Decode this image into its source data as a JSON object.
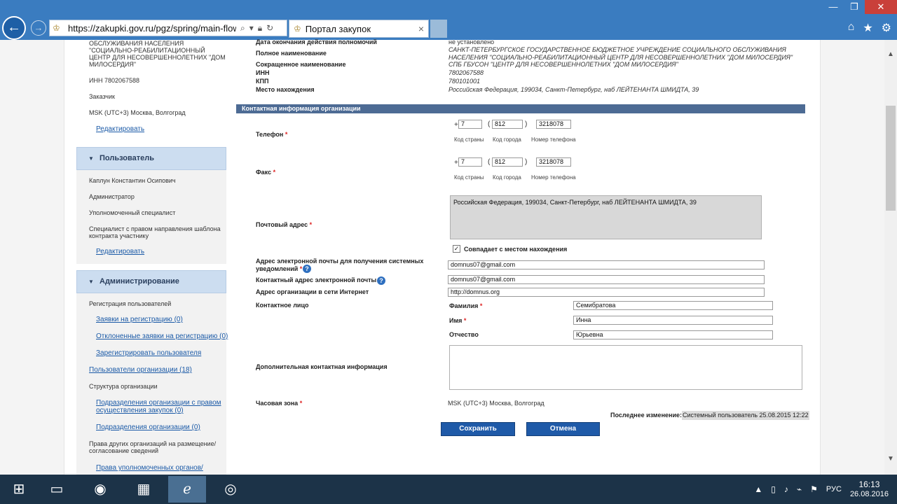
{
  "browser": {
    "url": "https://zakupki.gov.ru/pgz/spring/main-flow?",
    "tab_title": "Портал закупок",
    "tab_close": "×"
  },
  "sidebar": {
    "org_name_fragment": "ОБСЛУЖИВАНИЯ НАСЕЛЕНИЯ \"СОЦИАЛЬНО-РЕАБИЛИТАЦИОННЫЙ ЦЕНТР ДЛЯ НЕСОВЕРШЕННОЛЕТНИХ \"ДОМ МИЛОСЕРДИЯ\"",
    "inn": "ИНН 7802067588",
    "role": "Заказчик",
    "timezone": "MSK (UTC+3) Москва, Волгоград",
    "edit_link_1": "Редактировать",
    "user_header": "Пользователь",
    "user_name": "Каплун Константин Осипович",
    "user_role_1": "Администратор",
    "user_role_2": "Уполномоченный специалист",
    "user_role_3": "Специалист с правом направления шаблона контракта участнику",
    "edit_link_2": "Редактировать",
    "admin_header": "Администрирование",
    "reg_users": "Регистрация пользователей",
    "reg_requests": "Заявки на регистрацию (0)",
    "rejected_requests": "Отклоненные заявки на регистрацию (0)",
    "register_user": "Зарегистрировать пользователя",
    "org_users": "Пользователи организации (18)",
    "org_structure": "Структура организации",
    "subdivisions_with_right": "Подразделения организации с правом осуществления закупок (0)",
    "subdivisions": "Подразделения организации (0)",
    "other_org_rights": "Права других организаций на размещение/согласование сведений",
    "authorized_bodies": "Права уполномоченных органов/"
  },
  "org_info": {
    "auth_end_label": "Дата окончания действия полномочий",
    "auth_end_value": "не установлено",
    "full_name_label": "Полное наименование",
    "full_name_value": "САНКТ-ПЕТЕРБУРГСКОЕ ГОСУДАРСТВЕННОЕ БЮДЖЕТНОЕ УЧРЕЖДЕНИЕ СОЦИАЛЬНОГО ОБСЛУЖИВАНИЯ НАСЕЛЕНИЯ \"СОЦИАЛЬНО-РЕАБИЛИТАЦИОННЫЙ ЦЕНТР ДЛЯ НЕСОВЕРШЕННОЛЕТНИХ \"ДОМ МИЛОСЕРДИЯ\"",
    "short_name_label": "Сокращенное наименование",
    "short_name_value": "СПБ ГБУСОН \"ЦЕНТР ДЛЯ НЕСОВЕРШЕННОЛЕТНИХ \"ДОМ МИЛОСЕРДИЯ\"",
    "inn_label": "ИНН",
    "inn_value": "7802067588",
    "kpp_label": "КПП",
    "kpp_value": "780101001",
    "location_label": "Место нахождения",
    "location_value": "Российская Федерация, 199034, Санкт-Петербург, наб ЛЕЙТЕНАНТА ШМИДТА, 39"
  },
  "contact": {
    "section_title": "Контактная информация организации",
    "phone_label": "Телефон",
    "fax_label": "Факс",
    "req_mark": "*",
    "plus": "+",
    "open_paren": "(",
    "close_paren": ")",
    "phone_country": "7",
    "phone_city": "812",
    "phone_number": "3218078",
    "fax_country": "7",
    "fax_city": "812",
    "fax_number": "3218078",
    "country_code_caption": "Код страны",
    "city_code_caption": "Код города",
    "number_caption": "Номер телефона",
    "postal_label": "Почтовый адрес",
    "postal_value": "Российская Федерация, 199034, Санкт-Петербург, наб ЛЕЙТЕНАНТА ШМИДТА, 39",
    "same_as_location": "Совпадает с местом нахождения",
    "check_mark": "✓",
    "email_notify_label": "Адрес электронной почты для получения системных уведомлений",
    "email_notify_value": "domnus07@gmail.com",
    "email_contact_label": "Контактный адрес электронной почты",
    "email_contact_value": "domnus07@gmail.com",
    "website_label": "Адрес организации в сети Интернет",
    "website_value": "http://domnus.org",
    "contact_person_label": "Контактное лицо",
    "last_name_label": "Фамилия",
    "last_name_value": "Семибратова",
    "first_name_label": "Имя",
    "first_name_value": "Инна",
    "middle_name_label": "Отчество",
    "middle_name_value": "Юрьевна",
    "extra_info_label": "Дополнительная контактная информация",
    "timezone_label": "Часовая зона",
    "timezone_value": "MSK (UTC+3) Москва, Волгоград",
    "last_change_label": "Последнее изменение:",
    "last_change_value": "Системный пользователь 25.08.2015 12:22",
    "help": "?"
  },
  "buttons": {
    "save": "Сохранить",
    "cancel": "Отмена"
  },
  "taskbar": {
    "lang": "РУС",
    "time": "16:13",
    "date": "26.08.2016"
  },
  "colors": {
    "section_bar": "#4d6b94",
    "button": "#1f5aa8",
    "link": "#1b5aa7",
    "required": "#dd2222"
  }
}
